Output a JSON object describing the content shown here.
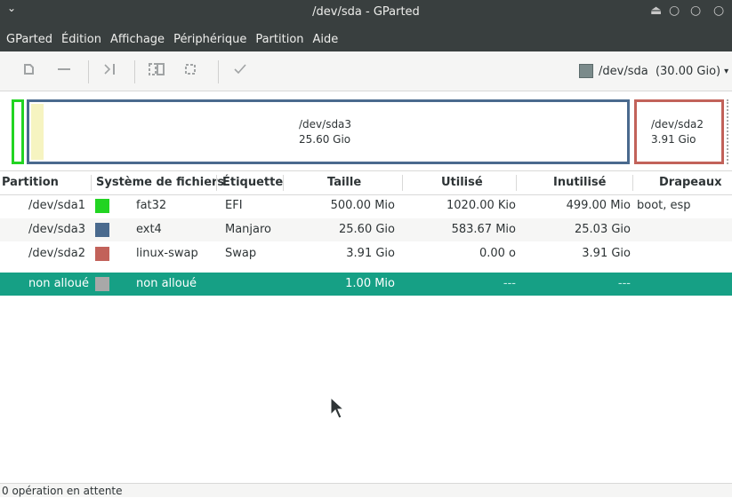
{
  "window": {
    "title": "/dev/sda - GParted",
    "chevron": "⌄",
    "eject_symbol": "⏏",
    "control_symbol": "○"
  },
  "menu": [
    "GParted",
    "Édition",
    "Affichage",
    "Périphérique",
    "Partition",
    "Aide"
  ],
  "toolbar": {
    "icons": [
      "new-partition-icon",
      "delete-icon",
      "resize-move-icon",
      "copy-icon",
      "paste-icon",
      "apply-icon"
    ],
    "device_selector": "/dev/sda  (30.00 Gio)",
    "arrow": "▾"
  },
  "partition_map": {
    "sda3": {
      "name": "/dev/sda3",
      "size": "25.60 Gio"
    },
    "sda2": {
      "name": "/dev/sda2",
      "size": "3.91 Gio"
    }
  },
  "table": {
    "headers": [
      "Partition",
      "Système de fichiers",
      "Étiquette",
      "Taille",
      "Utilisé",
      "Inutilisé",
      "Drapeaux"
    ],
    "rows": [
      {
        "partition": "/dev/sda1",
        "fs": "fat32",
        "color": "#22d422",
        "label": "EFI",
        "size": "500.00 Mio",
        "used": "1020.00 Kio",
        "unused": "499.00 Mio",
        "flags": "boot, esp"
      },
      {
        "partition": "/dev/sda3",
        "fs": "ext4",
        "color": "#4a6a8e",
        "label": "Manjaro",
        "size": "25.60 Gio",
        "used": "583.67 Mio",
        "unused": "25.03 Gio",
        "flags": ""
      },
      {
        "partition": "/dev/sda2",
        "fs": "linux-swap",
        "color": "#c2625a",
        "label": "Swap",
        "size": "3.91 Gio",
        "used": "0.00 o",
        "unused": "3.91 Gio",
        "flags": ""
      },
      {
        "partition": "non alloué",
        "fs": "non alloué",
        "color": "#a8a8a8",
        "label": "",
        "size": "1.00 Mio",
        "used": "---",
        "unused": "---",
        "flags": ""
      }
    ]
  },
  "status": "0 opération en attente",
  "colors": {
    "accent": "#16a085",
    "fat32": "#22d422",
    "ext4": "#4a6a8e",
    "swap": "#c2625a",
    "unallocated": "#a8a8a8"
  }
}
